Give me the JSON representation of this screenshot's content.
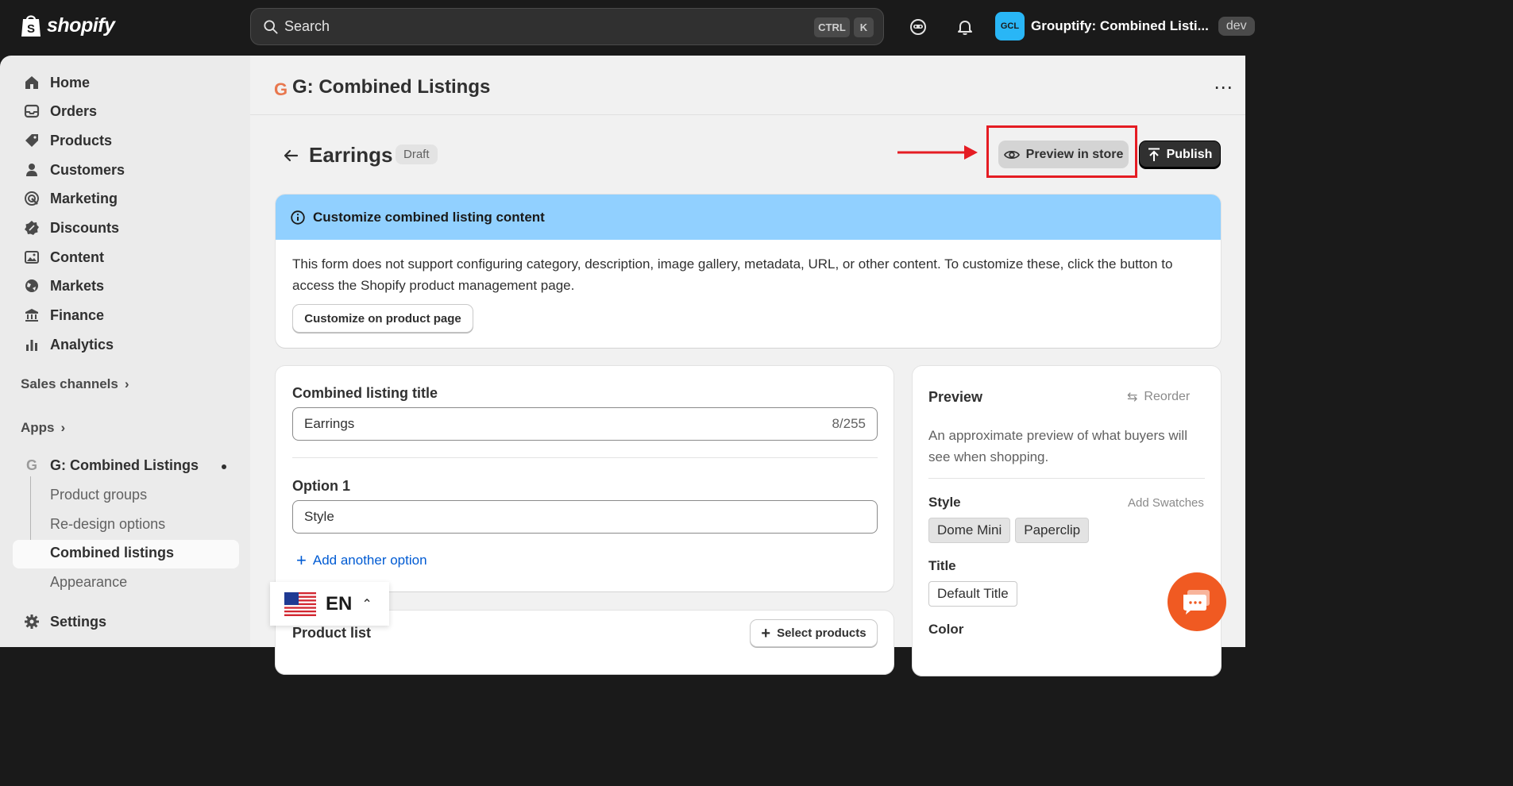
{
  "topbar": {
    "brand": "shopify",
    "search_placeholder": "Search",
    "shortcut_ctrl": "CTRL",
    "shortcut_k": "K",
    "store_avatar": "GCL",
    "store_name": "Grouptify: Combined Listi...",
    "store_badge": "dev"
  },
  "sidebar": {
    "items": [
      {
        "label": "Home",
        "icon": "home-icon"
      },
      {
        "label": "Orders",
        "icon": "inbox-icon"
      },
      {
        "label": "Products",
        "icon": "tag-icon"
      },
      {
        "label": "Customers",
        "icon": "person-icon"
      },
      {
        "label": "Marketing",
        "icon": "target-icon"
      },
      {
        "label": "Discounts",
        "icon": "discount-icon"
      },
      {
        "label": "Content",
        "icon": "image-icon"
      },
      {
        "label": "Markets",
        "icon": "globe-icon"
      },
      {
        "label": "Finance",
        "icon": "bank-icon"
      },
      {
        "label": "Analytics",
        "icon": "bar-chart-icon"
      }
    ],
    "sales_channels": "Sales channels",
    "apps": "Apps",
    "app_name": "G: Combined Listings",
    "app_subitems": [
      "Product groups",
      "Re-design options",
      "Combined listings",
      "Appearance"
    ],
    "settings": "Settings"
  },
  "app_header": {
    "logo_letter": "G",
    "title": "G: Combined Listings",
    "more": "⋯"
  },
  "page": {
    "title": "Earrings",
    "status": "Draft",
    "preview_button": "Preview in store",
    "publish_button": "Publish"
  },
  "banner": {
    "title": "Customize combined listing content",
    "body": "This form does not support configuring category, description, image gallery, metadata, URL, or other content. To customize these, click the button to access the Shopify product management page.",
    "button": "Customize on product page"
  },
  "form": {
    "title_label": "Combined listing title",
    "title_value": "Earrings",
    "title_count": "8/255",
    "option1_label": "Option 1",
    "option1_value": "Style",
    "add_option": "Add another option",
    "product_list_label": "Product list",
    "select_products": "Select products"
  },
  "preview_panel": {
    "heading": "Preview",
    "reorder": "Reorder",
    "description": "An approximate preview of what buyers will see when shopping.",
    "style_label": "Style",
    "add_swatches": "Add Swatches",
    "style_options": [
      "Dome Mini",
      "Paperclip"
    ],
    "title_label": "Title",
    "title_options": [
      "Default Title"
    ],
    "color_label": "Color"
  },
  "language": {
    "code": "EN"
  },
  "colors": {
    "accent_red": "#e51c23",
    "banner_blue": "#91d0ff",
    "chat_orange": "#f05a22",
    "link_blue": "#005bd3"
  }
}
